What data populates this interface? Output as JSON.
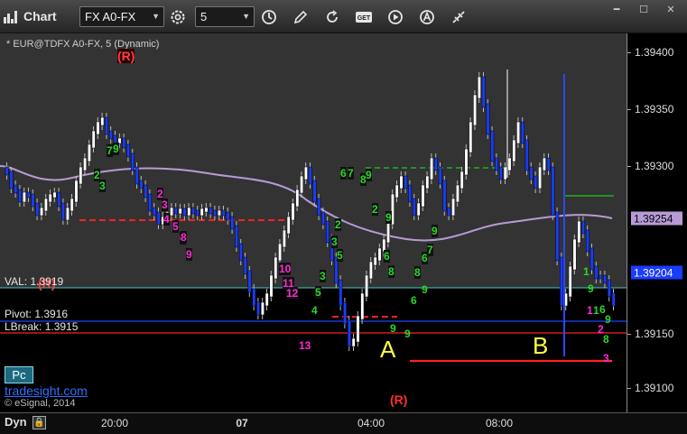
{
  "toolbar": {
    "title": "Chart",
    "symbol": "FX A0-FX",
    "interval": "5",
    "icons": [
      "chart-icon",
      "gear-icon",
      "clock-icon",
      "pencil-icon",
      "refresh-icon",
      "get-icon",
      "play-icon",
      "a-icon",
      "link-icon"
    ],
    "window": [
      "minimize-icon",
      "maximize-icon",
      "close-icon"
    ]
  },
  "chart": {
    "symbol_label": "* EUR@TDFX A0-FX, 5 (Dynamic)",
    "r_markers": [
      "(R)",
      "(R)",
      "(R)"
    ],
    "val_label": "VAL: 1.3919",
    "pivot_label": "Pivot:  1.3916",
    "lbreak_label": "LBreak: 1.3915",
    "letter_a": "A",
    "letter_b": "B",
    "pc_button": "Pc",
    "brand": "tradesight.com",
    "copyright": "© eSignal, 2014",
    "counts_magenta": [
      "2",
      "3",
      "4",
      "5",
      "6",
      "8",
      "9",
      "10",
      "11",
      "12",
      "13",
      "1",
      "2",
      "3."
    ],
    "counts_green": [
      "7",
      "9",
      "2",
      "3",
      "6",
      "7",
      "8",
      "9",
      "9",
      "9",
      "9",
      "6",
      "8",
      "2",
      "9",
      "2",
      "3",
      "5",
      "6",
      "7",
      "8",
      "6",
      "9",
      "3",
      "5",
      "4",
      "1",
      "1",
      "6",
      "9",
      "9",
      "8"
    ]
  },
  "axis": {
    "ticks": [
      "1.39400",
      "1.39350",
      "1.39300",
      "1.39150",
      "1.39100"
    ],
    "price_tags": [
      {
        "label": "1.39254",
        "bg": "#b79bd6",
        "fg": "#000000"
      },
      {
        "label": "1.39204",
        "bg": "#1a3cff",
        "fg": "#ffffff"
      }
    ]
  },
  "time_axis": {
    "labels": [
      "20:00",
      "07",
      "04:00",
      "08:00"
    ]
  },
  "bottom": {
    "dyn_label": "Dyn",
    "lock_icon": "lock-icon"
  },
  "colors": {
    "up_candle": "#ffffff",
    "down_candle": "#1a3cff",
    "moving_average": "#b79bd6",
    "count_magenta": "#ff2bd6",
    "count_green": "#2bd62b",
    "support_red": "#ff2020",
    "letters": "#ffff40"
  },
  "chart_data": {
    "type": "candlestick",
    "symbol": "EUR@TDFX A0-FX",
    "interval": "5",
    "y_ticks": [
      1.394,
      1.3935,
      1.393,
      1.3915,
      1.391
    ],
    "x_ticks": [
      "20:00",
      "07",
      "04:00",
      "08:00"
    ],
    "levels": {
      "val": 1.3919,
      "pivot": 1.3916,
      "lbreak": 1.3915
    },
    "last_price": 1.39204,
    "moving_average_last": 1.39254
  }
}
